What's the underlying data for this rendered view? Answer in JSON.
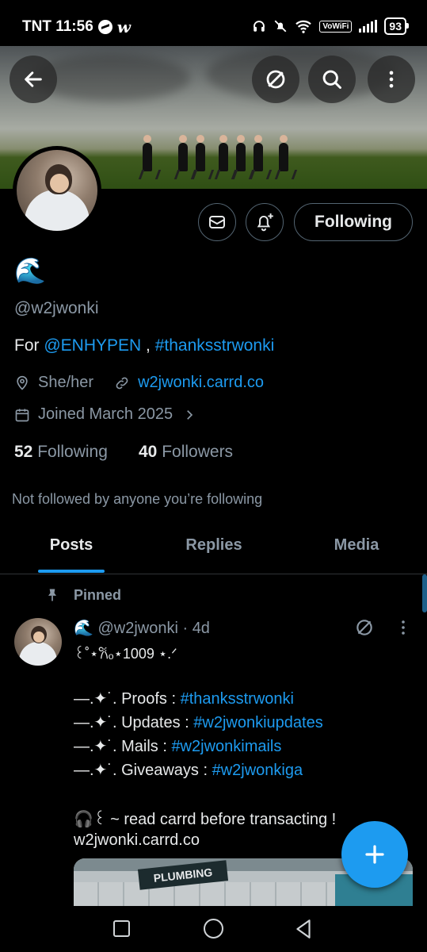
{
  "status_bar": {
    "carrier_time": "TNT 11:56",
    "vowifi": "VoWiFi",
    "battery": "93"
  },
  "profile": {
    "display_name": "🌊",
    "handle": "@w2jwonki",
    "bio_prefix": "For ",
    "bio_mention": "@ENHYPEN",
    "bio_separator": " , ",
    "bio_hashtag": "#thanksstrwonki",
    "pronouns": "She/her",
    "website": "w2jwonki.carrd.co",
    "joined": "Joined March 2025",
    "following_count": "52",
    "following_label": "Following",
    "followers_count": "40",
    "followers_label": "Followers",
    "not_followed_text": "Not followed by anyone you’re following",
    "follow_button_label": "Following"
  },
  "tabs": [
    "Posts",
    "Replies",
    "Media"
  ],
  "pinned_label": "Pinned",
  "tweet": {
    "name": "🌊",
    "handle_time": "@w2jwonki · 4d",
    "line1": "꒰˚⋆𐙚ₒ⋆1009 ⋆.ᐟ",
    "bullet_prefix": "—.✦˙.",
    "proofs_label": "Proofs : ",
    "proofs_tag": "#thanksstrwonki",
    "updates_label": "Updates : ",
    "updates_tag": "#w2jwonkiupdates",
    "mails_label": "Mails : ",
    "mails_tag": "#w2jwonkimails",
    "giveaways_label": "Giveaways : ",
    "giveaways_tag": "#w2jwonkiga",
    "note": "🎧꒰ ~ read carrd before transacting !",
    "link": "w2jwonki.carrd.co",
    "media_sign": "PLUMBING"
  },
  "colors": {
    "accent": "#1d9bf0",
    "muted": "#8b98a5",
    "background": "#000000"
  },
  "icons": [
    "back-arrow-icon",
    "grok-icon",
    "search-icon",
    "more-vertical-icon",
    "message-icon",
    "notification-bell-plus-icon",
    "location-pin-icon",
    "link-icon",
    "calendar-icon",
    "chevron-right-icon",
    "pin-icon",
    "compose-plus-icon"
  ]
}
